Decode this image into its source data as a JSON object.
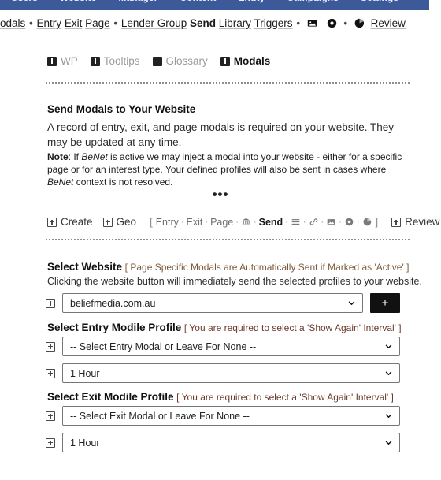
{
  "topnav": {
    "items": [
      "Users",
      "Website",
      "Manager",
      "Content",
      "Entity",
      "Campaigns",
      "Settings"
    ]
  },
  "breadcrumb": {
    "items": [
      {
        "text": "odals",
        "style": "link"
      },
      {
        "text": "•",
        "style": "sep"
      },
      {
        "text": "Entry",
        "style": "link"
      },
      {
        "text": "Exit",
        "style": "link"
      },
      {
        "text": "Page",
        "style": "link"
      },
      {
        "text": "•",
        "style": "sep"
      },
      {
        "text": "Lender Group",
        "style": "link"
      },
      {
        "text": "Send",
        "style": "bold"
      },
      {
        "text": "Library",
        "style": "link"
      },
      {
        "text": "Triggers",
        "style": "link"
      },
      {
        "text": "•",
        "style": "sep"
      },
      {
        "text": "image-icon",
        "style": "icon"
      },
      {
        "text": "record-circle-icon",
        "style": "icon"
      },
      {
        "text": "•",
        "style": "sep"
      },
      {
        "text": "pie-chart-icon",
        "style": "icon"
      },
      {
        "text": "Review",
        "style": "link"
      }
    ]
  },
  "tabs": [
    {
      "label": "WP",
      "active": false
    },
    {
      "label": "Tooltips",
      "active": false
    },
    {
      "label": "Glossary",
      "active": false
    },
    {
      "label": "Modals",
      "active": true
    }
  ],
  "section": {
    "heading": "Send Modals to Your Website",
    "paragraph": "A record of entry, exit, and page modals is required on your website. They may be updated at any time.",
    "note_label": "Note",
    "note_text_1": ": If ",
    "note_em_1": "BeNet",
    "note_text_2": " is active we may inject a modal into your website - either for a specific page or for an interest type. Your defined profiles will also be sent in cases where ",
    "note_em_2": "BeNet",
    "note_text_3": " context is not resolved.",
    "divider_dots": "•••"
  },
  "actionrow": {
    "create_label": "Create",
    "geo_label": "Geo",
    "bracket_open": "[",
    "bracket_close": "]",
    "items": [
      {
        "label": "Entry",
        "bold": false
      },
      {
        "label": "Exit",
        "bold": false
      },
      {
        "label": "Page",
        "bold": false
      },
      {
        "label": "bank-icon",
        "bold": false,
        "icon": true
      },
      {
        "label": "Send",
        "bold": true
      },
      {
        "label": "list-icon",
        "bold": false,
        "icon": true
      },
      {
        "label": "link-icon",
        "bold": false,
        "icon": true
      },
      {
        "label": "image-icon",
        "bold": false,
        "icon": true
      },
      {
        "label": "record-circle-icon",
        "bold": false,
        "icon": true
      },
      {
        "label": "pie-chart-icon",
        "bold": false,
        "icon": true
      }
    ],
    "review_label": "Review",
    "separator": "·"
  },
  "form": {
    "website": {
      "label": "Select Website",
      "hint": "[ Page Specific Modals are Automatically Sent if Marked as 'Active' ]",
      "subtext": "Clicking the website button will immediately send the selected profiles to your website.",
      "value": "beliefmedia.com.au",
      "add_button": "+"
    },
    "entry": {
      "label": "Select Entry Modile Profile",
      "hint": "[ You are required to select a 'Show Again' Interval' ]",
      "profile_value": "-- Select Entry Modal or Leave For None --",
      "interval_value": "1 Hour"
    },
    "exit": {
      "label": "Select Exit Modile Profile",
      "hint": "[ You are required to select a 'Show Again' Interval' ]",
      "profile_value": "-- Select Exit Modal or Leave For None --",
      "interval_value": "1 Hour"
    }
  },
  "colors": {
    "navbar": "#3c5a99",
    "hint": "#7a5a3c",
    "button": "#111111"
  }
}
